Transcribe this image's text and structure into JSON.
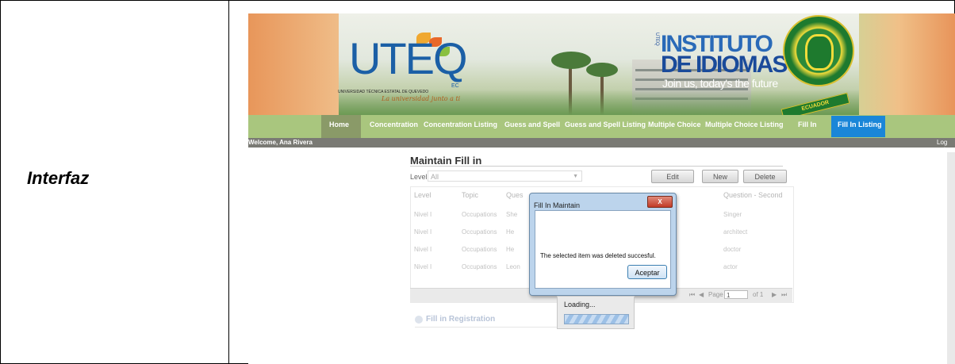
{
  "row_label": "Interfaz",
  "banner": {
    "logo_text": "UTEQ",
    "logo_sub": "UNIVERSIDAD TÉCNICA ESTATAL DE QUEVEDO",
    "logo_ec": "EC",
    "logo_motto": "La universidad junto a ti",
    "institute_line1": "INSTITUTO",
    "institute_line2": "DE IDIOMAS",
    "institute_tagline": "Join us, today's the future",
    "institute_prefix": "UTEQ",
    "seal_band": "ECUADOR"
  },
  "nav": {
    "items": [
      {
        "label": "Home"
      },
      {
        "label": "Concentration"
      },
      {
        "label": "Concentration Listing"
      },
      {
        "label": "Guess and Spell"
      },
      {
        "label": "Guess and Spell Listing"
      },
      {
        "label": "Multiple Choice"
      },
      {
        "label": "Multiple Choice Listing"
      },
      {
        "label": "Fill In"
      },
      {
        "label": "Fill In Listing"
      }
    ],
    "active": "Fill In Listing"
  },
  "welcome": "Welcome, Ana Rivera",
  "logout": "Log out",
  "panel": {
    "title": "Maintain Fill in",
    "level_label": "Level:",
    "level_value": "All",
    "buttons": {
      "edit": "Edit",
      "new": "New",
      "delete": "Delete"
    }
  },
  "grid": {
    "headers": [
      "Level",
      "Topic",
      "Ques",
      "Question - Second"
    ],
    "rows": [
      {
        "level": "Nivel I",
        "topic": "Occupations",
        "q": "She",
        "second": "Singer"
      },
      {
        "level": "Nivel I",
        "topic": "Occupations",
        "q": "He",
        "second": "architect"
      },
      {
        "level": "Nivel I",
        "topic": "Occupations",
        "q": "He",
        "second": "doctor"
      },
      {
        "level": "Nivel I",
        "topic": "Occupations",
        "q": "Leon",
        "second": "actor"
      }
    ],
    "pager": {
      "page_label": "Page",
      "page_value": "1",
      "of_label": "of 1"
    }
  },
  "dialog": {
    "title": "Fill In Maintain",
    "close": "X",
    "message": "The selected item was deleted succesful.",
    "ok": "Aceptar"
  },
  "loading": "Loading...",
  "fill_registration": "Fill in Registration",
  "colors": {
    "nav_bg": "#a9c67e",
    "nav_active": "#1a86d8",
    "dialog_frame": "#bcd4ec"
  }
}
